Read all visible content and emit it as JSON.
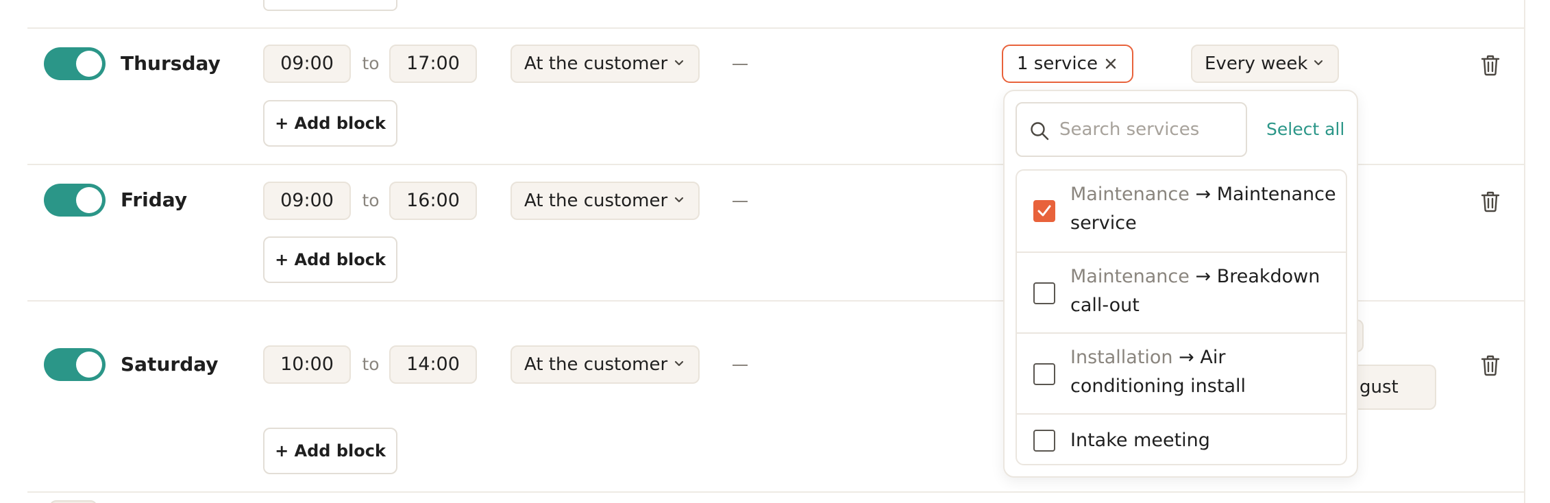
{
  "days": [
    {
      "name": "Thursday",
      "start": "09:00",
      "end": "17:00",
      "location": "At the customer",
      "dash": "—",
      "add_block": "+ Add block"
    },
    {
      "name": "Friday",
      "start": "09:00",
      "end": "16:00",
      "location": "At the customer",
      "dash": "—",
      "add_block": "+ Add block"
    },
    {
      "name": "Saturday",
      "start": "10:00",
      "end": "14:00",
      "location": "At the customer",
      "dash": "—",
      "add_block": "+ Add block"
    }
  ],
  "to_label": "to",
  "services_chip": {
    "label": "1 service"
  },
  "frequency": {
    "label": "Every week"
  },
  "partially_hidden_label": "gust",
  "service_dropdown": {
    "search_placeholder": "Search services",
    "select_all": "Select all",
    "options": [
      {
        "category": "Maintenance",
        "arrow": "→",
        "name": "Maintenance service",
        "checked": true
      },
      {
        "category": "Maintenance",
        "arrow": "→",
        "name": "Breakdown call-out",
        "checked": false
      },
      {
        "category": "Installation",
        "arrow": "→",
        "name": "Air conditioning install",
        "checked": false
      },
      {
        "category": "",
        "arrow": "",
        "name": "Intake meeting",
        "checked": false
      }
    ]
  },
  "colors": {
    "toggle_on": "#2b9688",
    "accent_orange": "#e8623b",
    "select_all_teal": "#2b9688",
    "pill_bg": "#f7f3ee"
  },
  "icons": {
    "remove_day": "trash-icon",
    "search": "search-icon",
    "dropdown": "chevron-down-icon",
    "clear": "close-icon"
  }
}
